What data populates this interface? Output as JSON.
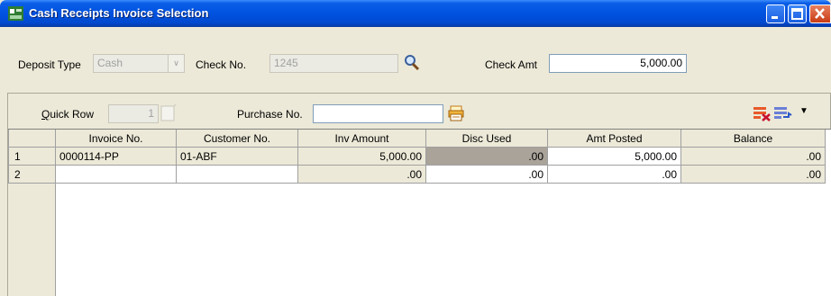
{
  "window": {
    "title": "Cash Receipts Invoice Selection"
  },
  "header": {
    "deposit_type_label": "Deposit Type",
    "deposit_type_value": "Cash",
    "check_no_label": "Check No.",
    "check_no_value": "1245",
    "check_amt_label": "Check Amt",
    "check_amt_value": "5,000.00"
  },
  "toolbar": {
    "quick_row_label_underlined": "Q",
    "quick_row_label_rest": "uick Row",
    "quick_row_value": "1",
    "purchase_no_label": "Purchase No.",
    "purchase_no_value": ""
  },
  "grid": {
    "columns": [
      "Invoice No.",
      "Customer No.",
      "Inv Amount",
      "Disc Used",
      "Amt Posted",
      "Balance"
    ],
    "rows": [
      {
        "num": "1",
        "invoice": "0000114-PP",
        "customer": "01-ABF",
        "inv_amount": "5,000.00",
        "disc_used": ".00",
        "amt_posted": "5,000.00",
        "balance": ".00"
      },
      {
        "num": "2",
        "invoice": "",
        "customer": "",
        "inv_amount": ".00",
        "disc_used": ".00",
        "amt_posted": ".00",
        "balance": ".00"
      }
    ]
  },
  "colors": {
    "titlebar": "#0052e0",
    "window_bg": "#ece9d8",
    "selected_cell": "#a9a39a"
  }
}
